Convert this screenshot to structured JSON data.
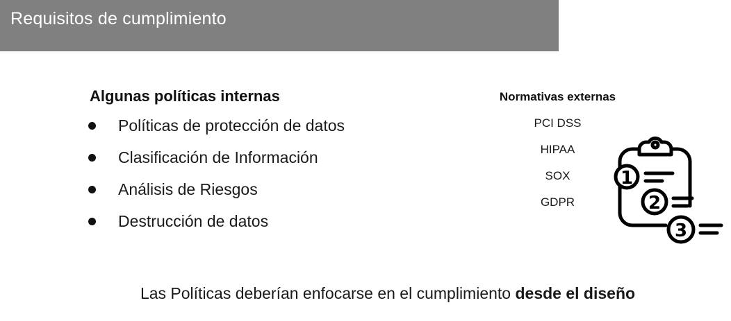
{
  "header": {
    "title": "Requisitos de cumplimiento"
  },
  "internal": {
    "heading": "Algunas políticas internas",
    "items": [
      "Políticas de protección de datos",
      "Clasificación de Información",
      "Análisis de Riesgos",
      "Destrucción de datos"
    ]
  },
  "external": {
    "heading": "Normativas externas",
    "items": [
      "PCI DSS",
      "HIPAA",
      "SOX",
      "GDPR"
    ]
  },
  "illustration": {
    "icon": "clipboard-checklist-icon",
    "numbers": [
      "1",
      "2",
      "3"
    ]
  },
  "footer": {
    "text_plain": "Las Políticas deberían enfocarse en el cumplimiento ",
    "text_bold": "desde el diseño"
  },
  "colors": {
    "title_bar": "#808080",
    "title_text": "#ffffff",
    "text": "#1a1a1a"
  }
}
